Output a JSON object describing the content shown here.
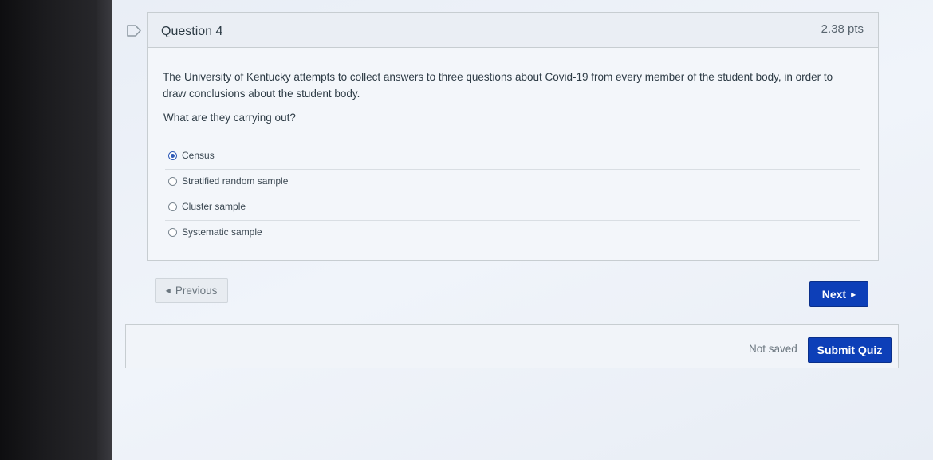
{
  "question": {
    "title": "Question 4",
    "points": "2.38 pts",
    "text": "The University of Kentucky attempts to collect answers to three questions about Covid-19 from every member of the student body, in order to draw conclusions about the student body.",
    "prompt": "What are they carrying out?",
    "answers": [
      {
        "label": "Census",
        "selected": true
      },
      {
        "label": "Stratified random sample",
        "selected": false
      },
      {
        "label": "Cluster sample",
        "selected": false
      },
      {
        "label": "Systematic sample",
        "selected": false
      }
    ]
  },
  "nav": {
    "previous_label": "Previous",
    "next_label": "Next"
  },
  "footer": {
    "save_status": "Not saved",
    "submit_label": "Submit Quiz"
  },
  "colors": {
    "primary_button": "#0d3fb8",
    "selected_radio": "#2f5bb7"
  },
  "icons": {
    "flag": "flag-outline-icon",
    "previous": "caret-left-icon",
    "next": "caret-right-icon"
  }
}
